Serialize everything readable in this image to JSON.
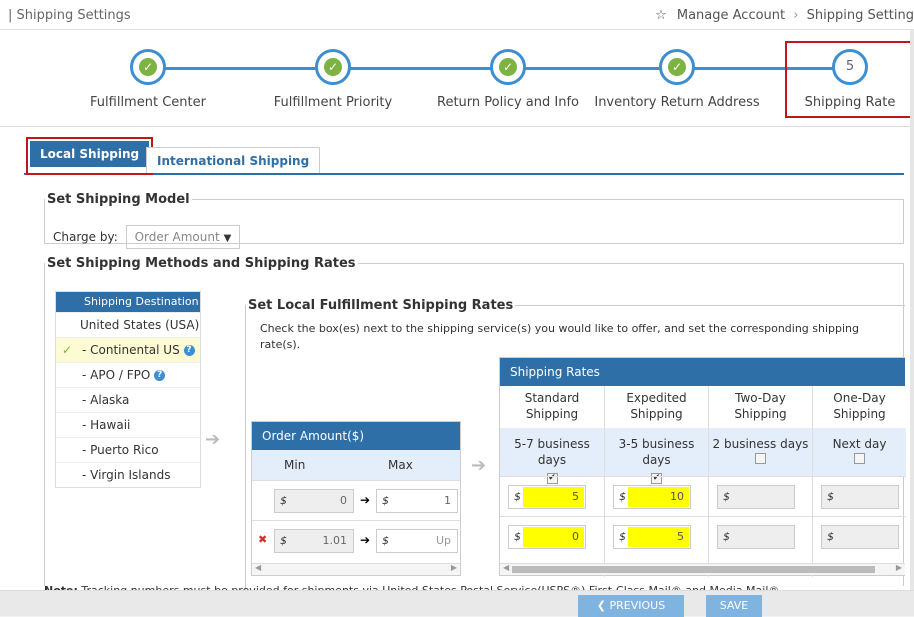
{
  "header": {
    "page_title": "Shipping Settings",
    "star_icon": "☆",
    "breadcrumb": [
      "Manage Account",
      "Shipping Setting"
    ]
  },
  "steps": [
    {
      "label": "Fulfillment Center",
      "status": "done"
    },
    {
      "label": "Fulfillment Priority",
      "status": "done"
    },
    {
      "label": "Return Policy and Info",
      "status": "done"
    },
    {
      "label": "Inventory Return Address",
      "status": "done"
    },
    {
      "label": "Shipping Rate",
      "status": "current",
      "number": "5"
    }
  ],
  "tabs": {
    "local": "Local Shipping",
    "international": "International Shipping"
  },
  "shipping_model": {
    "legend": "Set Shipping Model",
    "charge_by_label": "Charge by:",
    "charge_by_value": "Order Amount"
  },
  "methods": {
    "legend": "Set Shipping Methods and Shipping Rates",
    "destination_header": "Shipping Destination",
    "destinations": [
      {
        "label": "United States (USA)",
        "selected": false,
        "help": false
      },
      {
        "label": "- Continental US",
        "selected": true,
        "help": true
      },
      {
        "label": "- APO / FPO",
        "selected": false,
        "help": true
      },
      {
        "label": "- Alaska",
        "selected": false,
        "help": false
      },
      {
        "label": "- Hawaii",
        "selected": false,
        "help": false
      },
      {
        "label": "- Puerto Rico",
        "selected": false,
        "help": false
      },
      {
        "label": "- Virgin Islands",
        "selected": false,
        "help": false
      }
    ]
  },
  "local_rates": {
    "legend": "Set Local Fulfillment Shipping Rates",
    "description": "Check the box(es) next to the shipping service(s) you would like to offer, and set the corresponding shipping rate(s)."
  },
  "order_amount": {
    "header": "Order Amount($)",
    "min_label": "Min",
    "max_label": "Max",
    "rows": [
      {
        "min": "0",
        "max": "1"
      },
      {
        "min": "1.01",
        "max": "Up"
      }
    ]
  },
  "rates": {
    "header": "Shipping Rates",
    "services": [
      {
        "name_line1": "Standard",
        "name_line2": "Shipping",
        "days": "5-7 business days",
        "checked": true,
        "values": [
          "5",
          "0"
        ]
      },
      {
        "name_line1": "Expedited",
        "name_line2": "Shipping",
        "days": "3-5 business days",
        "checked": true,
        "values": [
          "10",
          "5"
        ]
      },
      {
        "name_line1": "Two-Day",
        "name_line2": "Shipping",
        "days": "2 business days",
        "checked": false,
        "values": [
          "",
          ""
        ]
      },
      {
        "name_line1": "One-Day",
        "name_line2": "Shipping",
        "days": "Next day",
        "checked": false,
        "values": [
          "",
          ""
        ]
      }
    ]
  },
  "currency_symbol": "$",
  "note": {
    "bold": "Note:",
    "text": " Tracking numbers must be provided for shipments via United States Postal Service(USPS®) First-Class Mail® and Media Mail®"
  },
  "footer": {
    "previous": "PREVIOUS",
    "save": "SAVE"
  },
  "colors": {
    "accent": "#2f6fa8",
    "highlight_border": "#c0161c",
    "check_green": "#7cb342",
    "input_yellow": "#ffff00"
  }
}
